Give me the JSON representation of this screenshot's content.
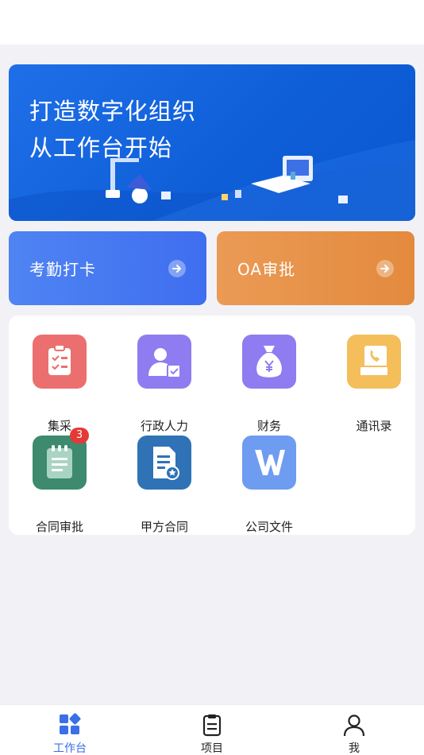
{
  "banner": {
    "line1": "打造数字化组织",
    "line2": "从工作台开始"
  },
  "quick_actions": [
    {
      "label": "考勤打卡",
      "icon": "arrow-right-icon"
    },
    {
      "label": "OA审批",
      "icon": "arrow-right-icon"
    }
  ],
  "apps": [
    {
      "label": "集采",
      "icon": "clipboard-check-icon",
      "color": "#ec6f6f"
    },
    {
      "label": "行政人力",
      "icon": "person-badge-icon",
      "color": "#8f7cf0"
    },
    {
      "label": "财务",
      "icon": "money-bag-icon",
      "color": "#8f7cf0"
    },
    {
      "label": "通讯录",
      "icon": "phone-book-icon",
      "color": "#f4be5b"
    },
    {
      "label": "合同审批",
      "icon": "notepad-icon",
      "color": "#3d8a6e",
      "badge": "3"
    },
    {
      "label": "甲方合同",
      "icon": "document-star-icon",
      "color": "#2f72b5"
    },
    {
      "label": "公司文件",
      "icon": "word-file-icon",
      "color": "#6e9cf0"
    }
  ],
  "tabs": [
    {
      "label": "工作台",
      "icon": "grid-icon",
      "active": true
    },
    {
      "label": "项目",
      "icon": "clipboard-icon",
      "active": false
    },
    {
      "label": "我",
      "icon": "user-icon",
      "active": false
    }
  ],
  "colors": {
    "accent": "#3a6fe6",
    "badge": "#e53935"
  }
}
